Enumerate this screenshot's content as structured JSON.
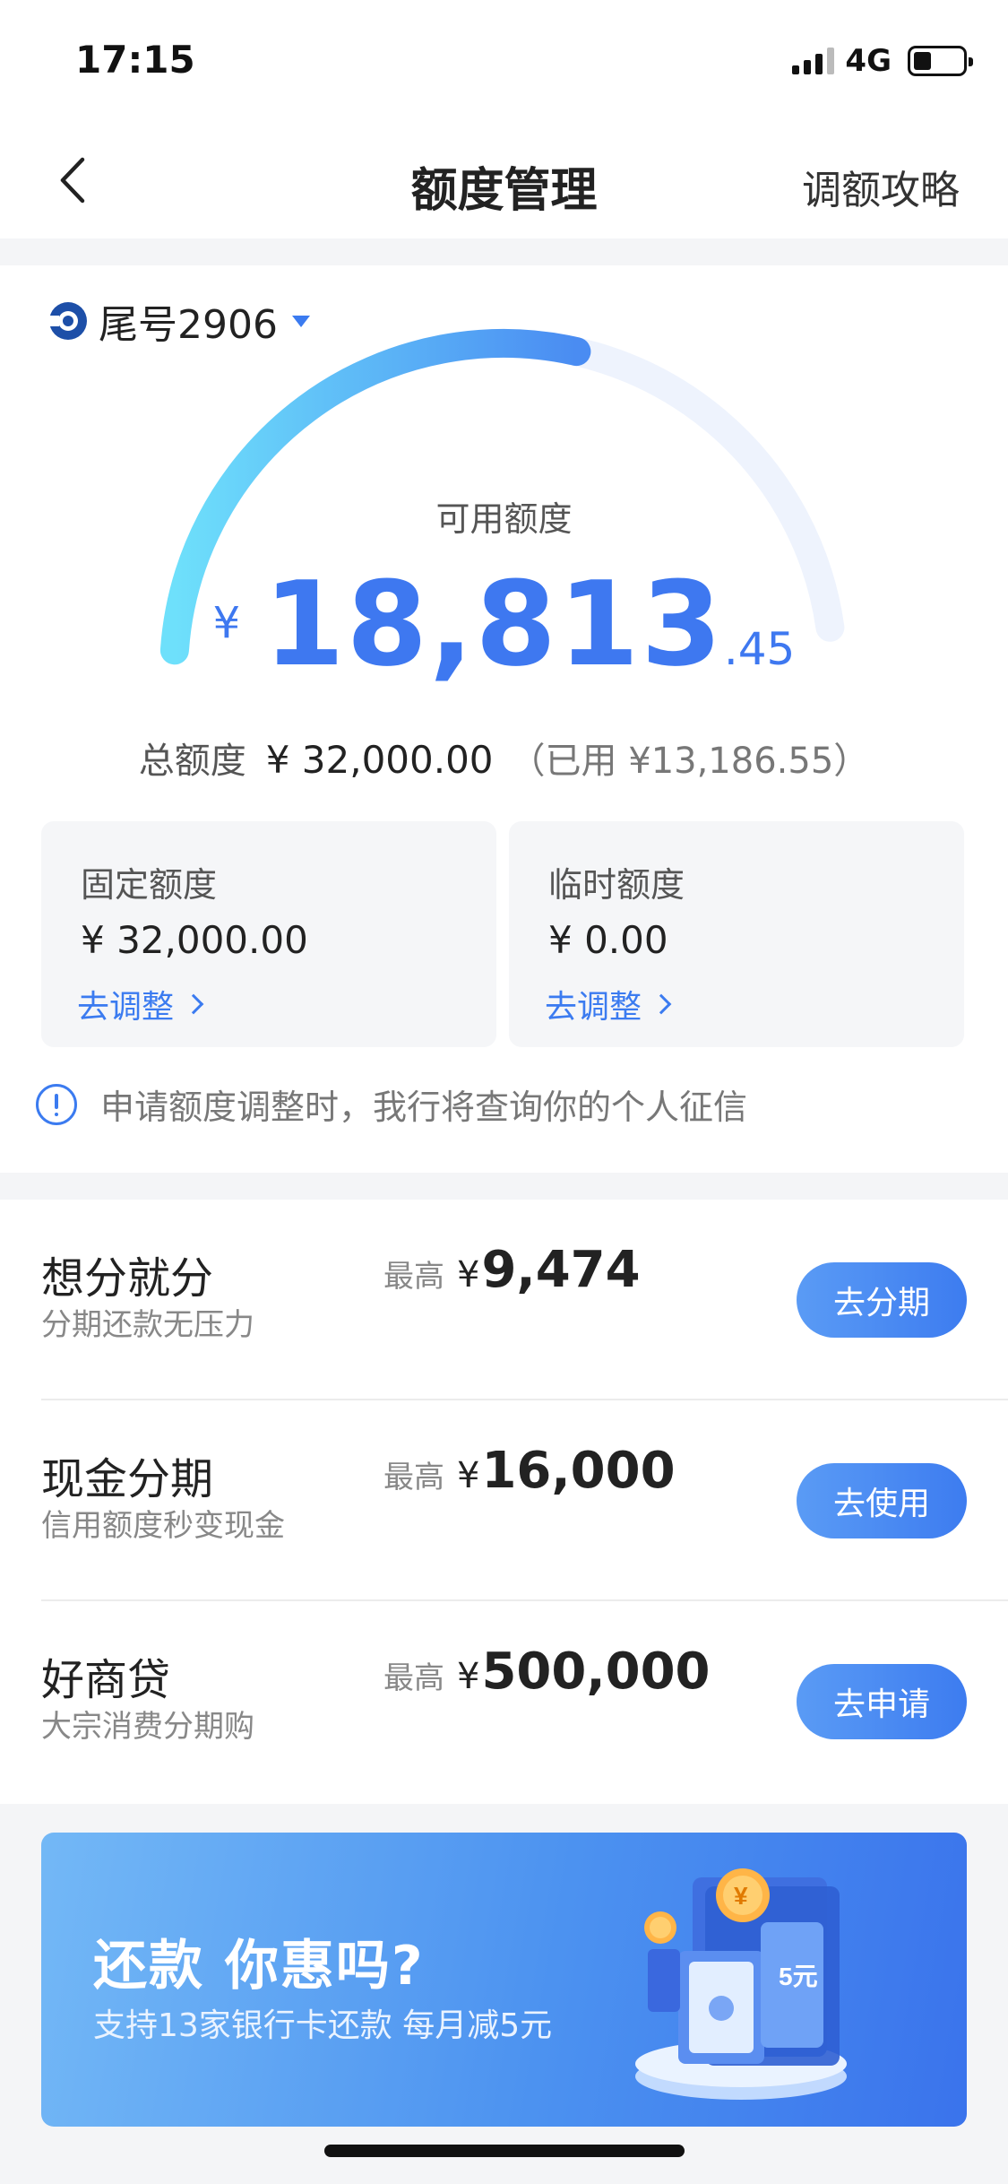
{
  "status_bar": {
    "time": "17:15",
    "network": "4G",
    "battery_level": 0.35
  },
  "nav": {
    "title": "额度管理",
    "right_link": "调额攻略"
  },
  "card": {
    "label": "尾号2906",
    "gauge": {
      "caption": "可用额度",
      "currency": "¥",
      "integer": "18,813",
      "decimal": ".45",
      "used_fraction": 0.588
    },
    "total": {
      "label": "总额度",
      "value": "¥ 32,000.00",
      "used": "（已用 ¥13,186.55）"
    },
    "fixed": {
      "title": "固定额度",
      "value": "¥ 32,000.00",
      "link": "去调整"
    },
    "temporary": {
      "title": "临时额度",
      "value": "¥ 0.00",
      "link": "去调整"
    },
    "notice": "申请额度调整时，我行将查询你的个人征信"
  },
  "products": [
    {
      "name": "想分就分",
      "desc": "分期还款无压力",
      "max_label": "最高",
      "currency": "¥",
      "max_value": "9,474",
      "button": "去分期"
    },
    {
      "name": "现金分期",
      "desc": "信用额度秒变现金",
      "max_label": "最高",
      "currency": "¥",
      "max_value": "16,000",
      "button": "去使用"
    },
    {
      "name": "好商贷",
      "desc": "大宗消费分期购",
      "max_label": "最高",
      "currency": "¥",
      "max_value": "500,000",
      "button": "去申请"
    }
  ],
  "banner": {
    "title": "还款 你惠吗?",
    "subtitle": "支持13家银行卡还款 每月减5元",
    "coin_symbol": "¥",
    "ticket_text": "5元"
  },
  "colors": {
    "accent": "#3e78f0",
    "gauge_start": "#6ee0fb",
    "gauge_end": "#4a8cf2",
    "track": "#eef3fd"
  }
}
